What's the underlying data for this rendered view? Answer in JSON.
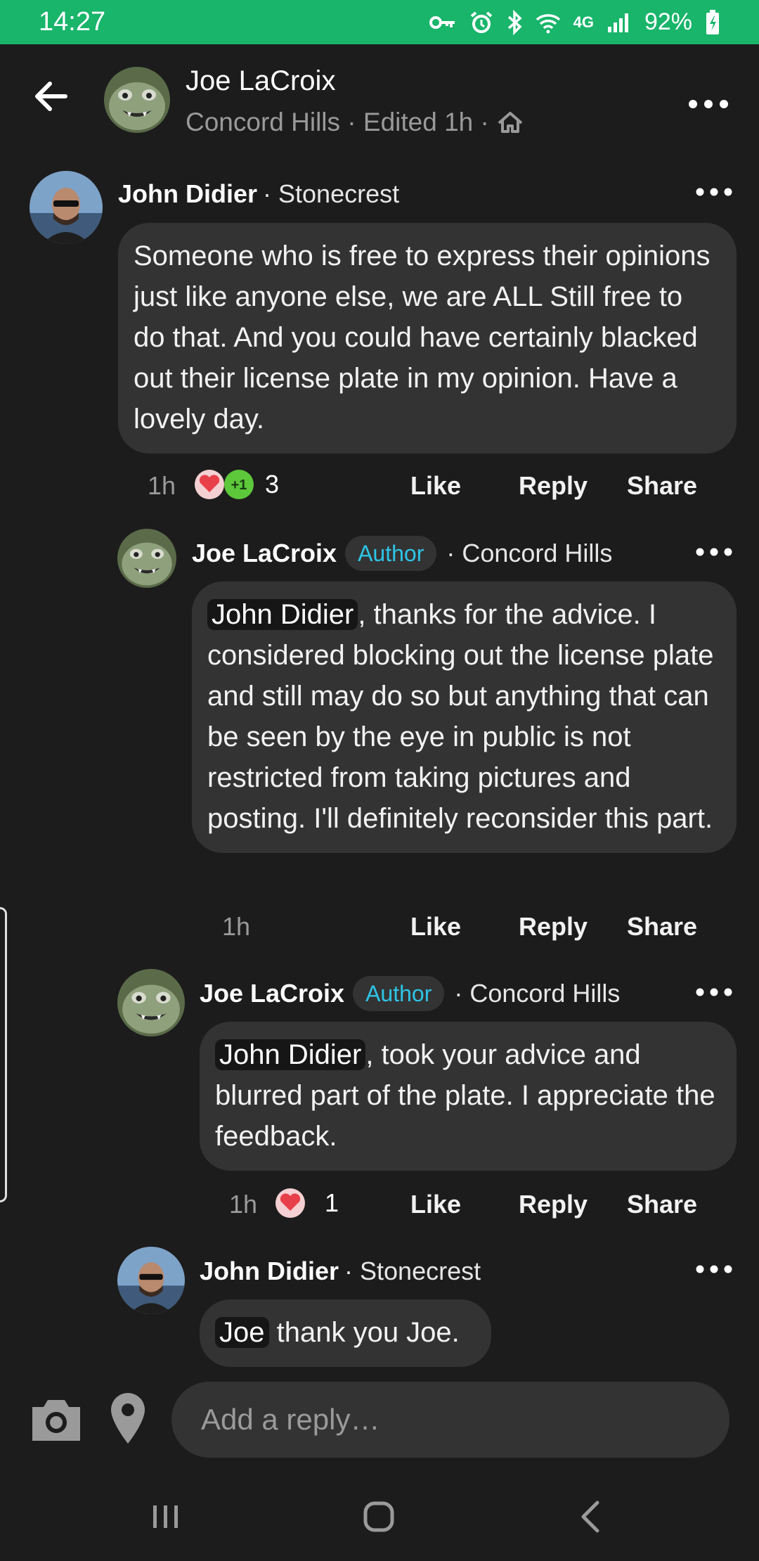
{
  "status_bar": {
    "time": "14:27",
    "battery": "92%",
    "network": "4G"
  },
  "header": {
    "title": "Joe LaCroix",
    "subtitle": "Concord Hills · Edited 1h ·"
  },
  "comments": [
    {
      "author": "John Didier",
      "meta": "· Stonecrest",
      "text": "Someone who is free to express their opinions just like anyone else, we are ALL Still free to do that. And you could have certainly blacked out their license plate in my opinion. Have a lovely day.",
      "time": "1h",
      "reaction_count": "3",
      "like": "Like",
      "reply": "Reply",
      "share": "Share"
    },
    {
      "author": "Joe LaCroix",
      "badge": "Author",
      "meta": "· Concord Hills",
      "mention": "John Didier",
      "text": ", thanks for the advice. I considered blocking out the license plate and still may do so but anything that can be seen by the eye in public is not restricted from taking pictures and posting. I'll definitely reconsider this part.",
      "time": "1h",
      "like": "Like",
      "reply": "Reply",
      "share": "Share"
    },
    {
      "author": "Joe LaCroix",
      "badge": "Author",
      "meta": "· Concord Hills",
      "mention": "John Didier",
      "text": ", took your advice and blurred part of the plate. I appreciate the feedback.",
      "time": "1h",
      "reaction_count": "1",
      "like": "Like",
      "reply": "Reply",
      "share": "Share"
    },
    {
      "author": "John Didier",
      "meta": "· Stonecrest",
      "mention": "Joe",
      "text": " thank you Joe."
    }
  ],
  "reply_bar": {
    "placeholder": "Add a reply…"
  },
  "colors": {
    "status_bar": "#18b56b",
    "background": "#1c1c1c",
    "bubble": "#333333",
    "author_badge_text": "#2ec4e6",
    "heart": "#e8404a",
    "plus_one": "#5cc83a"
  }
}
